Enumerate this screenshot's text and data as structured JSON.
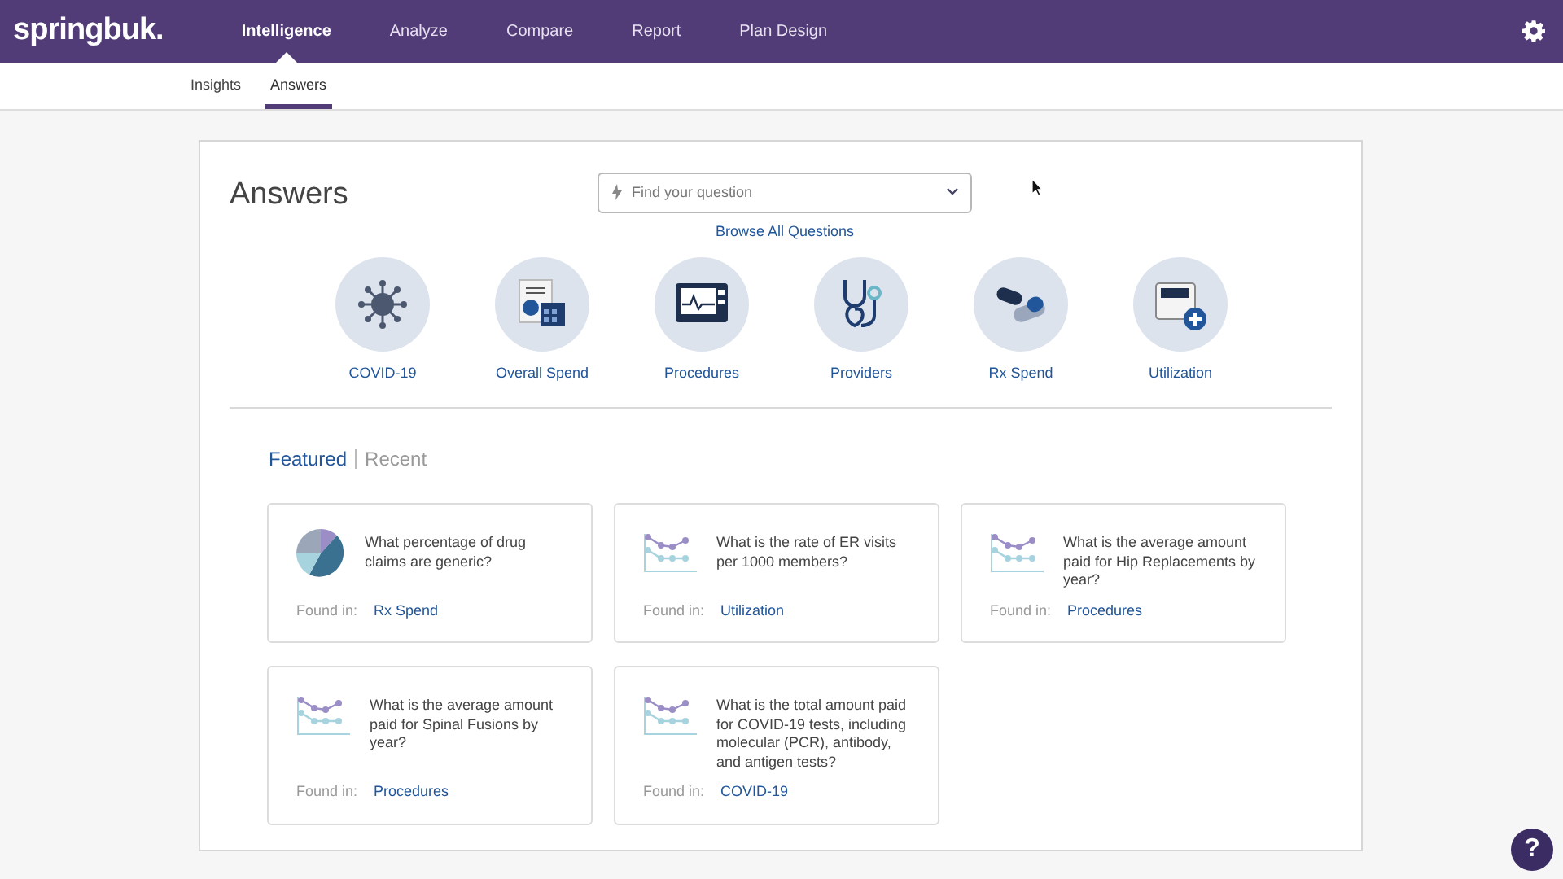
{
  "brand": "springbuk.",
  "nav": [
    {
      "label": "Intelligence",
      "selected": true
    },
    {
      "label": "Analyze",
      "selected": false
    },
    {
      "label": "Compare",
      "selected": false
    },
    {
      "label": "Report",
      "selected": false
    },
    {
      "label": "Plan Design",
      "selected": false
    }
  ],
  "subnav": [
    {
      "label": "Insights",
      "selected": false
    },
    {
      "label": "Answers",
      "selected": true
    }
  ],
  "title": "Answers",
  "search": {
    "placeholder": "Find your question"
  },
  "browse_link": "Browse All Questions",
  "categories": [
    {
      "label": "COVID-19",
      "kind": "virus"
    },
    {
      "label": "Overall Spend",
      "kind": "spend"
    },
    {
      "label": "Procedures",
      "kind": "monitor"
    },
    {
      "label": "Providers",
      "kind": "stethoscope"
    },
    {
      "label": "Rx Spend",
      "kind": "pills"
    },
    {
      "label": "Utilization",
      "kind": "ambulance"
    }
  ],
  "question_tabs": [
    {
      "label": "Featured",
      "selected": true
    },
    {
      "label": "Recent",
      "selected": false
    }
  ],
  "questions": [
    {
      "kind": "pie",
      "text": "What percentage of drug claims are generic?",
      "found_label": "Found in:",
      "found": "Rx Spend"
    },
    {
      "kind": "line",
      "text": "What is the rate of ER visits per 1000 members?",
      "found_label": "Found in:",
      "found": "Utilization"
    },
    {
      "kind": "line",
      "text": "What is the average amount paid for Hip Replacements by year?",
      "found_label": "Found in:",
      "found": "Procedures"
    },
    {
      "kind": "line",
      "text": "What is the average amount paid for Spinal Fusions by year?",
      "found_label": "Found in:",
      "found": "Procedures"
    },
    {
      "kind": "line",
      "text": "What is the total amount paid for COVID-19 tests, including molecular (PCR), antibody, and antigen tests?",
      "found_label": "Found in:",
      "found": "COVID-19"
    }
  ],
  "help": "?"
}
